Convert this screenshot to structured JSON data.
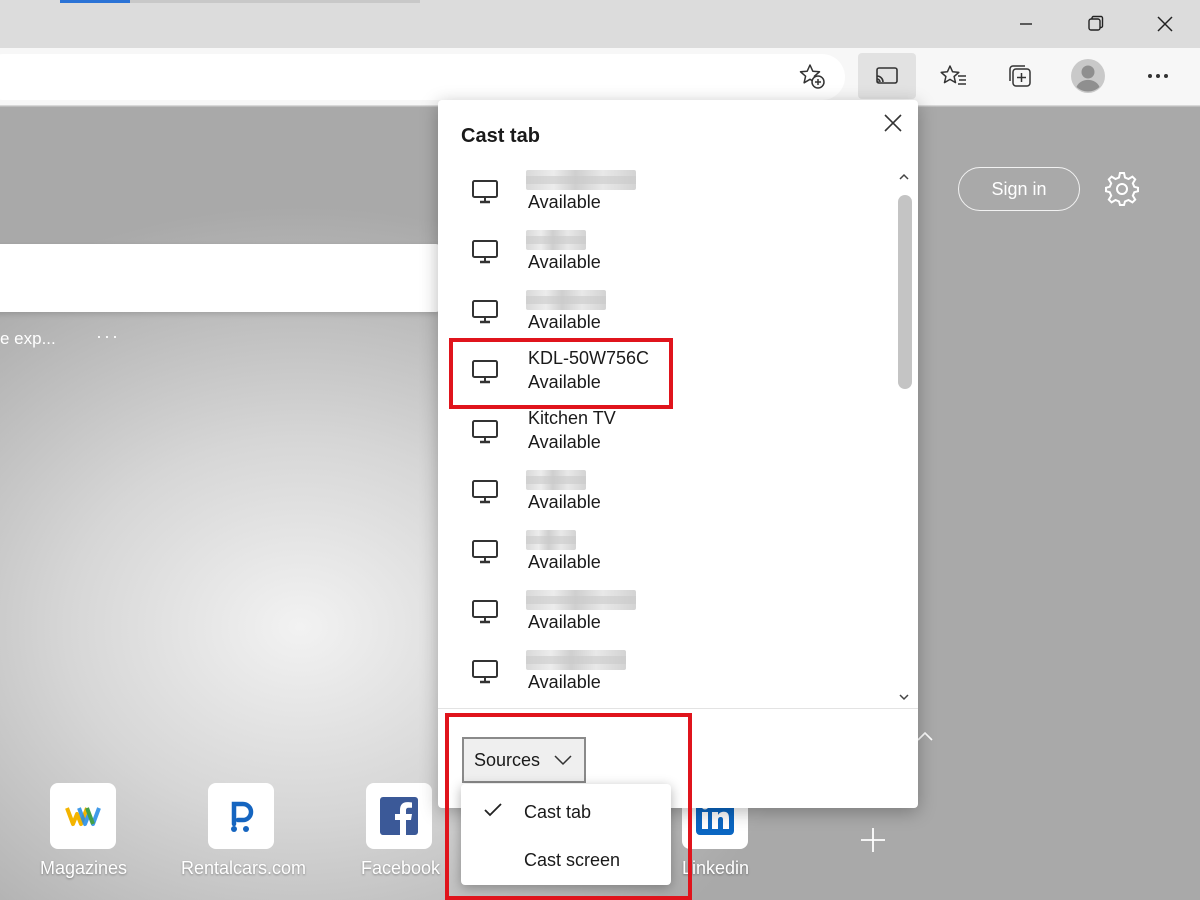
{
  "window": {
    "minimize_icon": "minimize-icon",
    "maximize_icon": "restore-icon",
    "close_icon": "close-icon"
  },
  "toolbar": {
    "icons": [
      "add-favorite-icon",
      "cast-icon",
      "favorites-icon",
      "collections-icon",
      "profile-icon",
      "more-icon"
    ],
    "active_button": "cast"
  },
  "page": {
    "signin_label": "Sign in",
    "news_snippet": "e exp...",
    "news_more": "···",
    "quick_links": [
      {
        "label": "Magazines",
        "icon": "magazines-icon"
      },
      {
        "label": "Rentalcars.com",
        "icon": "rentalcars-icon"
      },
      {
        "label": "Facebook",
        "icon": "facebook-icon"
      },
      {
        "label": "Linkedin",
        "icon": "linkedin-icon"
      }
    ]
  },
  "cast": {
    "title": "Cast tab",
    "devices": [
      {
        "name": "",
        "status": "Available",
        "obscured": true
      },
      {
        "name": "",
        "status": "Available",
        "obscured": true
      },
      {
        "name": "",
        "status": "Available",
        "obscured": true
      },
      {
        "name": "KDL-50W756C",
        "status": "Available",
        "obscured": false
      },
      {
        "name": "Kitchen TV",
        "status": "Available",
        "obscured": false
      },
      {
        "name": "",
        "status": "Available",
        "obscured": true
      },
      {
        "name": "",
        "status": "Available",
        "obscured": true
      },
      {
        "name": "",
        "status": "Available",
        "obscured": true
      },
      {
        "name": "",
        "status": "Available",
        "obscured": true
      }
    ],
    "sources_label": "Sources",
    "sources_menu": [
      {
        "label": "Cast tab",
        "checked": true
      },
      {
        "label": "Cast screen",
        "checked": false
      }
    ]
  },
  "colors": {
    "highlight": "#e0141c",
    "accent": "#2b73d6",
    "facebook": "#3b5998",
    "linkedin": "#0a66c2"
  }
}
